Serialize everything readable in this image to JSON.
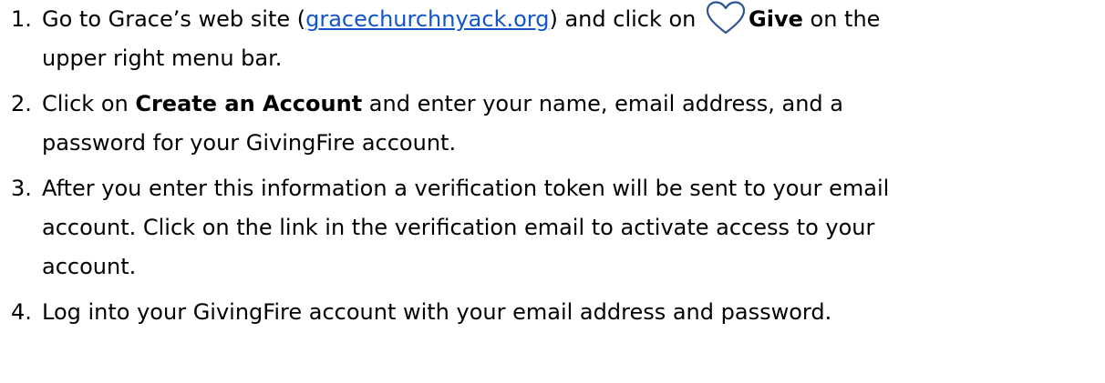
{
  "steps": [
    {
      "number": "1.",
      "before_link": "Go to Grace’s web site (",
      "link_text": "gracechurchnyack.org",
      "after_link": ") and click on ",
      "bold": "Give",
      "after_bold_line1": " on the",
      "line2": "upper right menu bar.",
      "icon": "heart-outline-icon",
      "icon_color": "#2f5597"
    },
    {
      "number": "2.",
      "before_bold": "Click on ",
      "bold": "Create an Account",
      "after_bold_line1": " and enter your name, email address, and a",
      "line2": "password for your GivingFire account."
    },
    {
      "number": "3.",
      "line1": "After you enter this information a verification token will be sent to your email",
      "line2": "account.  Click on the link in the verification email to activate access to your",
      "line3": "account."
    },
    {
      "number": "4.",
      "line1": "Log into your GivingFire account with your email address and password."
    }
  ],
  "colors": {
    "link": "#1155cc",
    "text": "#000000",
    "background": "#ffffff"
  }
}
